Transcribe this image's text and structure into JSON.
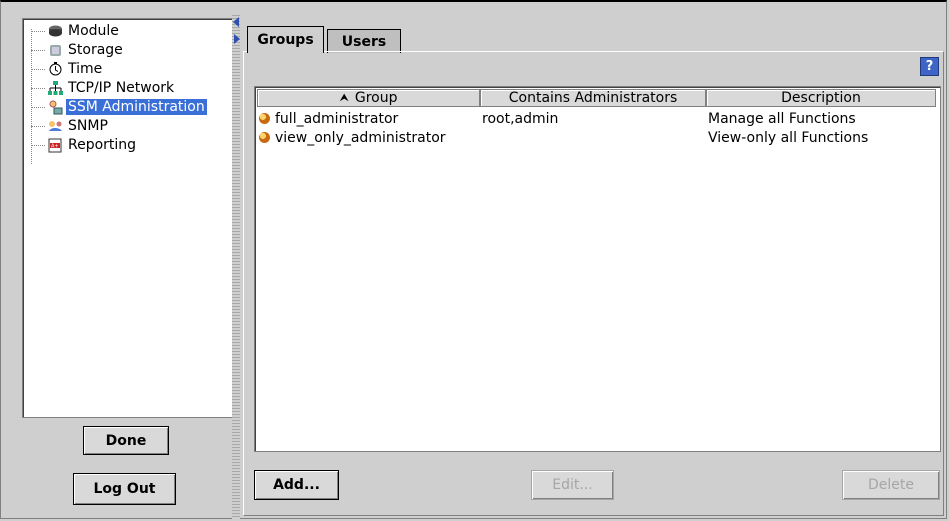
{
  "tree": {
    "items": [
      {
        "label": "Module",
        "icon": "module-icon"
      },
      {
        "label": "Storage",
        "icon": "storage-icon"
      },
      {
        "label": "Time",
        "icon": "clock-icon"
      },
      {
        "label": "TCP/IP Network",
        "icon": "network-icon"
      },
      {
        "label": "SSM Administration",
        "icon": "admin-icon",
        "selected": true
      },
      {
        "label": "SNMP",
        "icon": "snmp-icon"
      },
      {
        "label": "Reporting",
        "icon": "report-icon"
      }
    ]
  },
  "left_buttons": {
    "done": "Done",
    "logout": "Log Out"
  },
  "tabs": [
    {
      "label": "Groups",
      "active": true
    },
    {
      "label": "Users",
      "active": false
    }
  ],
  "help": "?",
  "table": {
    "columns": [
      "Group",
      "Contains Administrators",
      "Description"
    ],
    "sort_icon": "sort-up-icon",
    "rows": [
      {
        "group": "full_administrator",
        "admins": "root,admin",
        "description": "Manage all Functions"
      },
      {
        "group": "view_only_administrator",
        "admins": "",
        "description": "View-only all Functions"
      }
    ]
  },
  "actions": {
    "add": "Add...",
    "edit": "Edit...",
    "delete": "Delete"
  },
  "colors": {
    "selection": "#3b6fd8",
    "background": "#cfcfcf"
  }
}
